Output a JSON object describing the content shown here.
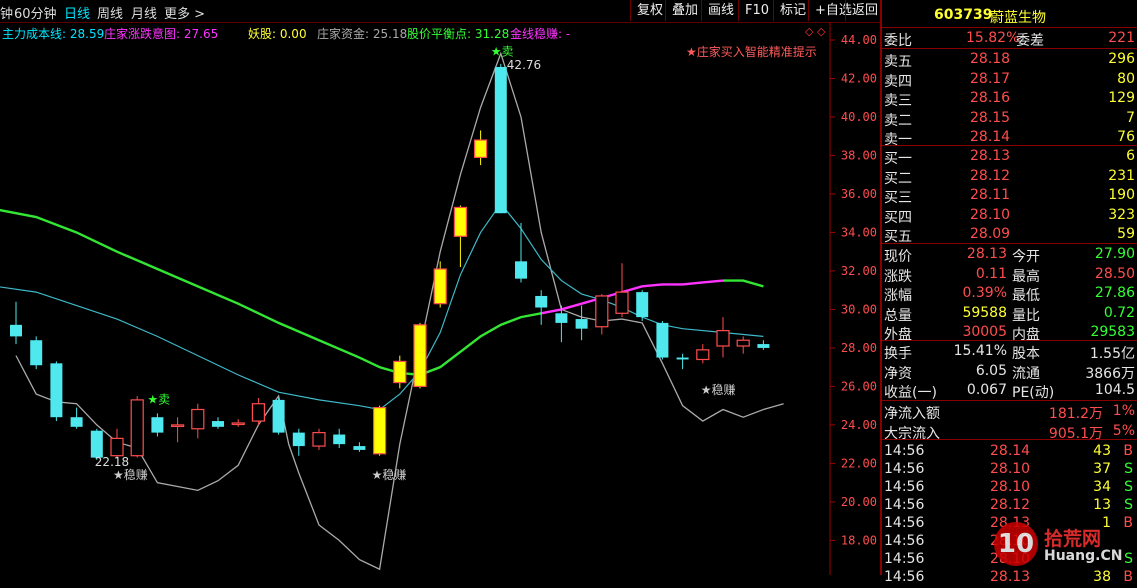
{
  "toolbar": {
    "periods": [
      "钟",
      "60分钟",
      "日线",
      "周线",
      "月线",
      "更多 >"
    ],
    "active_period": "日线",
    "buttons": [
      "复权",
      "叠加",
      "画线",
      "F10",
      "标记",
      "+自选",
      "返回"
    ]
  },
  "indicators": [
    {
      "label": "主力成本线: 28.59",
      "color": "#00e5ff"
    },
    {
      "label": "庄家涨跌意图: 27.65",
      "color": "#ff33ff"
    },
    {
      "label": "妖股: 0.00",
      "color": "#ffff33"
    },
    {
      "label": "庄家资金: 25.18",
      "color": "#aaaaaa"
    },
    {
      "label": "股价平衡点: 31.28",
      "color": "#33ff33"
    },
    {
      "label": "金线稳赚: -",
      "color": "#ff33ff"
    }
  ],
  "chart_hint": "★庄家买入智能精准提示",
  "chart_data": {
    "type": "candlestick",
    "y_ticks": [
      "44.00",
      "42.00",
      "40.00",
      "38.00",
      "36.00",
      "34.00",
      "32.00",
      "30.00",
      "28.00",
      "26.00",
      "24.00",
      "22.00",
      "20.00",
      "18.00"
    ],
    "ylim": [
      17.5,
      44.0
    ],
    "candles": [
      {
        "o": 29.2,
        "c": 28.6,
        "h": 30.4,
        "l": 28.2
      },
      {
        "o": 28.4,
        "c": 27.1,
        "h": 28.6,
        "l": 26.9
      },
      {
        "o": 27.2,
        "c": 24.4,
        "h": 27.3,
        "l": 24.2
      },
      {
        "o": 24.4,
        "c": 23.9,
        "h": 24.9,
        "l": 23.8
      },
      {
        "o": 23.7,
        "c": 22.3,
        "h": 23.8,
        "l": 22.18
      },
      {
        "o": 22.4,
        "c": 23.3,
        "h": 23.8,
        "l": 22.3
      },
      {
        "o": 22.4,
        "c": 25.3,
        "h": 25.5,
        "l": 22.3
      },
      {
        "o": 24.4,
        "c": 23.6,
        "h": 24.6,
        "l": 23.4
      },
      {
        "o": 24.0,
        "c": 24.0,
        "h": 24.4,
        "l": 23.1
      },
      {
        "o": 23.8,
        "c": 24.8,
        "h": 25.1,
        "l": 23.3
      },
      {
        "o": 24.2,
        "c": 23.9,
        "h": 24.4,
        "l": 23.8
      },
      {
        "o": 24.1,
        "c": 24.1,
        "h": 24.3,
        "l": 23.9
      },
      {
        "o": 24.2,
        "c": 25.1,
        "h": 25.4,
        "l": 24.0
      },
      {
        "o": 25.3,
        "c": 23.6,
        "h": 25.4,
        "l": 23.5
      },
      {
        "o": 23.6,
        "c": 22.9,
        "h": 23.8,
        "l": 22.4
      },
      {
        "o": 22.9,
        "c": 23.6,
        "h": 23.8,
        "l": 22.7
      },
      {
        "o": 23.5,
        "c": 23.0,
        "h": 23.8,
        "l": 22.8
      },
      {
        "o": 22.9,
        "c": 22.7,
        "h": 23.1,
        "l": 22.6
      },
      {
        "o": 22.5,
        "c": 24.9,
        "h": 25.0,
        "l": 22.4
      },
      {
        "o": 26.2,
        "c": 27.3,
        "h": 27.6,
        "l": 25.9
      },
      {
        "o": 26.0,
        "c": 29.2,
        "h": 29.3,
        "l": 25.9
      },
      {
        "o": 30.3,
        "c": 32.1,
        "h": 32.5,
        "l": 30.1
      },
      {
        "o": 33.8,
        "c": 35.3,
        "h": 35.4,
        "l": 32.2
      },
      {
        "o": 37.9,
        "c": 38.8,
        "h": 39.3,
        "l": 37.5
      },
      {
        "o": 42.6,
        "c": 35.0,
        "h": 42.76,
        "l": 35.0
      },
      {
        "o": 32.5,
        "c": 31.6,
        "h": 34.5,
        "l": 31.4
      },
      {
        "o": 30.7,
        "c": 30.1,
        "h": 31.0,
        "l": 29.2
      },
      {
        "o": 29.8,
        "c": 29.3,
        "h": 30.2,
        "l": 28.3
      },
      {
        "o": 29.5,
        "c": 29.0,
        "h": 30.2,
        "l": 28.4
      },
      {
        "o": 29.1,
        "c": 30.7,
        "h": 30.8,
        "l": 28.7
      },
      {
        "o": 29.8,
        "c": 30.9,
        "h": 32.4,
        "l": 29.6
      },
      {
        "o": 30.9,
        "c": 29.6,
        "h": 31.0,
        "l": 29.4
      },
      {
        "o": 29.3,
        "c": 27.5,
        "h": 29.4,
        "l": 27.4
      },
      {
        "o": 27.5,
        "c": 27.4,
        "h": 27.7,
        "l": 26.9
      },
      {
        "o": 27.4,
        "c": 27.9,
        "h": 28.2,
        "l": 27.2
      },
      {
        "o": 28.1,
        "c": 28.9,
        "h": 29.6,
        "l": 27.5
      },
      {
        "o": 28.1,
        "c": 28.4,
        "h": 28.6,
        "l": 27.7
      },
      {
        "o": 28.2,
        "c": 28.0,
        "h": 28.4,
        "l": 27.9
      }
    ],
    "annotations": [
      {
        "text": "22.18",
        "color": "#dddddd"
      },
      {
        "text": "42.76",
        "color": "#dddddd"
      },
      {
        "text": "★卖",
        "color": "#33ff33"
      },
      {
        "text": "★卖",
        "color": "#33ff33"
      },
      {
        "text": "★稳赚",
        "color": "#cccccc"
      },
      {
        "text": "★稳赚",
        "color": "#cccccc"
      },
      {
        "text": "★稳赚",
        "color": "#cccccc"
      }
    ]
  },
  "panel": {
    "stock_code": "603739",
    "stock_name": "蔚蓝生物",
    "weibi": {
      "label": "委比",
      "value": "15.82%",
      "label2": "委差",
      "value2": "221"
    },
    "sell_orders": [
      {
        "label": "卖五",
        "price": "28.18",
        "vol": "296"
      },
      {
        "label": "卖四",
        "price": "28.17",
        "vol": "80"
      },
      {
        "label": "卖三",
        "price": "28.16",
        "vol": "129"
      },
      {
        "label": "卖二",
        "price": "28.15",
        "vol": "7"
      },
      {
        "label": "卖一",
        "price": "28.14",
        "vol": "76"
      }
    ],
    "buy_orders": [
      {
        "label": "买一",
        "price": "28.13",
        "vol": "6"
      },
      {
        "label": "买二",
        "price": "28.12",
        "vol": "231"
      },
      {
        "label": "买三",
        "price": "28.11",
        "vol": "190"
      },
      {
        "label": "买四",
        "price": "28.10",
        "vol": "323"
      },
      {
        "label": "买五",
        "price": "28.09",
        "vol": "59"
      }
    ],
    "quote1": [
      {
        "l1": "现价",
        "v1": "28.13",
        "c1": "red",
        "l2": "今开",
        "v2": "27.90",
        "c2": "green"
      },
      {
        "l1": "涨跌",
        "v1": "0.11",
        "c1": "red",
        "l2": "最高",
        "v2": "28.50",
        "c2": "red"
      },
      {
        "l1": "涨幅",
        "v1": "0.39%",
        "c1": "red",
        "l2": "最低",
        "v2": "27.86",
        "c2": "green"
      },
      {
        "l1": "总量",
        "v1": "59588",
        "c1": "yellow",
        "l2": "量比",
        "v2": "0.72",
        "c2": "green"
      },
      {
        "l1": "外盘",
        "v1": "30005",
        "c1": "red",
        "l2": "内盘",
        "v2": "29583",
        "c2": "green"
      }
    ],
    "quote2": [
      {
        "l1": "换手",
        "v1": "15.41%",
        "c1": "white",
        "l2": "股本",
        "v2": "1.55亿",
        "c2": "white"
      },
      {
        "l1": "净资",
        "v1": "6.05",
        "c1": "white",
        "l2": "流通",
        "v2": "3866万",
        "c2": "white"
      },
      {
        "l1": "收益(一)",
        "v1": "0.067",
        "c1": "white",
        "l2": "PE(动)",
        "v2": "104.5",
        "c2": "white"
      }
    ],
    "flows": [
      {
        "label": "净流入额",
        "value": "181.2万",
        "pct": "1%"
      },
      {
        "label": "大宗流入",
        "value": "905.1万",
        "pct": "5%"
      }
    ],
    "ticks": [
      {
        "time": "14:56",
        "price": "28.14",
        "vol": "43",
        "side": "B"
      },
      {
        "time": "14:56",
        "price": "28.10",
        "vol": "37",
        "side": "S"
      },
      {
        "time": "14:56",
        "price": "28.10",
        "vol": "34",
        "side": "S"
      },
      {
        "time": "14:56",
        "price": "28.12",
        "vol": "13",
        "side": "S"
      },
      {
        "time": "14:56",
        "price": "28.13",
        "vol": "1",
        "side": "B"
      },
      {
        "time": "14:56",
        "price": "28.10",
        "vol": "",
        "side": ""
      },
      {
        "time": "14:56",
        "price": "28.10",
        "vol": "",
        "side": "S"
      },
      {
        "time": "14:56",
        "price": "28.13",
        "vol": "38",
        "side": "B"
      }
    ],
    "watermark": "10 拾荒网 Huang.CN"
  }
}
